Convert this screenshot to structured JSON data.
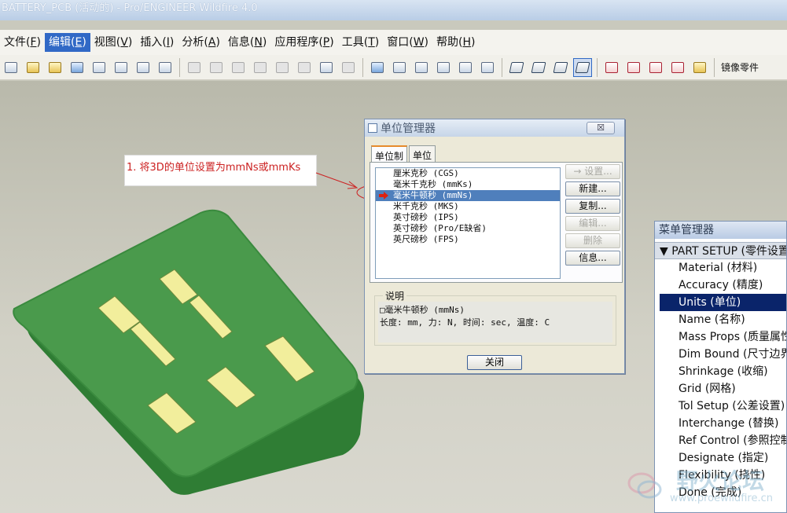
{
  "window": {
    "title": "BATTERY_PCB (活动的) - Pro/ENGINEER Wildfire 4.0"
  },
  "menubar": {
    "items": [
      {
        "text": "文件",
        "key": "F",
        "active": false
      },
      {
        "text": "编辑",
        "key": "E",
        "active": true
      },
      {
        "text": "视图",
        "key": "V",
        "active": false
      },
      {
        "text": "插入",
        "key": "I",
        "active": false
      },
      {
        "text": "分析",
        "key": "A",
        "active": false
      },
      {
        "text": "信息",
        "key": "N",
        "active": false
      },
      {
        "text": "应用程序",
        "key": "P",
        "active": false
      },
      {
        "text": "工具",
        "key": "T",
        "active": false
      },
      {
        "text": "窗口",
        "key": "W",
        "active": false
      },
      {
        "text": "帮助",
        "key": "H",
        "active": false
      }
    ]
  },
  "toolbar": {
    "mirror_label": "镜像零件"
  },
  "annotation": {
    "text": "1. 将3D的单位设置为mmNs或mmKs"
  },
  "dialog": {
    "title": "单位管理器",
    "close_x": "☒",
    "tabs": [
      "单位制",
      "单位"
    ],
    "systems": [
      "厘米克秒 (CGS)",
      "毫米千克秒 (mmKs)",
      "毫米牛顿秒 (mmNs)",
      "米千克秒 (MKS)",
      "英寸磅秒 (IPS)",
      "英寸磅秒 (Pro/E缺省)",
      "英尺磅秒 (FPS)"
    ],
    "selected_index": 2,
    "buttons": [
      {
        "label": "→ 设置...",
        "enabled": false
      },
      {
        "label": "新建...",
        "enabled": true
      },
      {
        "label": "复制...",
        "enabled": true
      },
      {
        "label": "编辑...",
        "enabled": false
      },
      {
        "label": "删除",
        "enabled": false
      },
      {
        "label": "信息...",
        "enabled": true
      }
    ],
    "description_legend": "说明",
    "description_line1": "□毫米牛顿秒 (mmNs)",
    "description_line2": "长度: mm, 力: N, 时间: sec, 温度: C",
    "close_label": "关闭"
  },
  "menu_manager": {
    "title": "菜单管理器",
    "section": "▼ PART SETUP (零件设置)",
    "items": [
      "Material (材料)",
      "Accuracy (精度)",
      "Units (单位)",
      "Name (名称)",
      "Mass Props (质量属性)",
      "Dim Bound (尺寸边界)",
      "Shrinkage (收缩)",
      "Grid (网格)",
      "Tol Setup (公差设置)",
      "Interchange (替换)",
      "Ref Control (参照控制)",
      "Designate (指定)",
      "Flexibility (挠性)",
      "Done (完成)"
    ],
    "selected_index": 2
  },
  "watermark": {
    "line1": "野火论坛",
    "line2": "www.proewildfire.cn"
  },
  "colors": {
    "menu_highlight": "#3169c6",
    "pcb_green": "#4a9a4c",
    "pad_yellow": "#f2ee9c",
    "annotation_red": "#cc2222"
  }
}
